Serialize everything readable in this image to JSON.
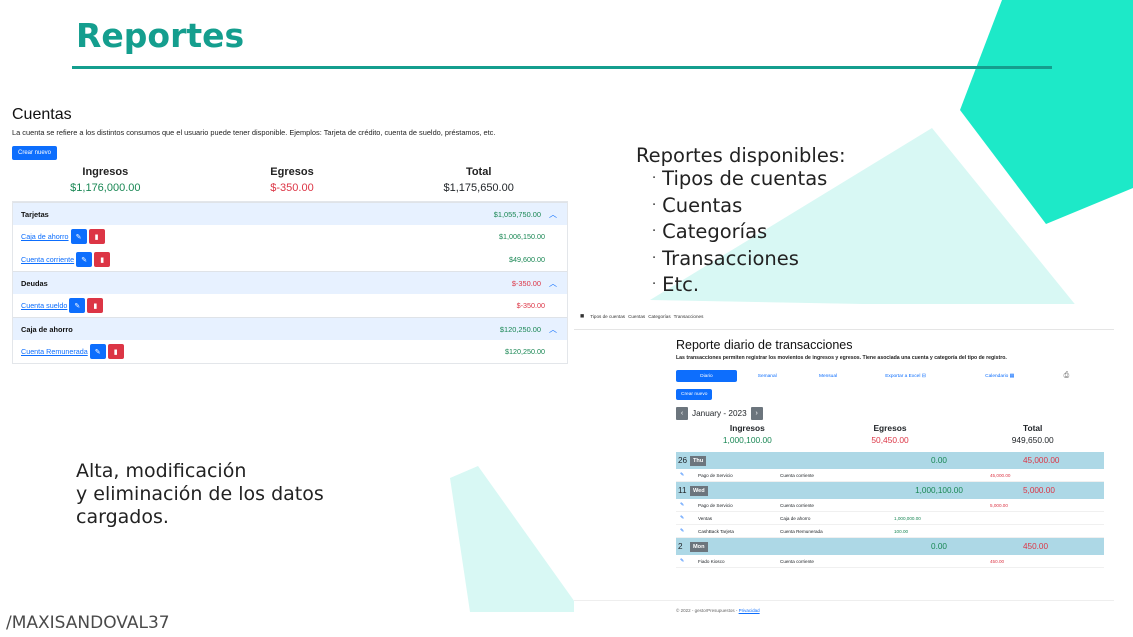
{
  "slide": {
    "title": "Reportes",
    "footer_handle": "/MAXISANDOVAL37",
    "abm_line1": "Alta, modificación",
    "abm_line2": "y eliminación de los datos",
    "abm_line3": "cargados.",
    "reports_heading": "Reportes disponibles:",
    "reports_list": [
      "Tipos de cuentas",
      "Cuentas",
      "Categorías",
      "Transacciones",
      "Etc."
    ],
    "colors": {
      "accent": "#149e8e",
      "deco_teal": "#1de9c8",
      "deco_light": "#d8f8f4"
    }
  },
  "cuentas": {
    "title": "Cuentas",
    "description": "La cuenta se refiere a los distintos consumos que el usuario puede tener disponible. Ejemplos: Tarjeta de crédito, cuenta de sueldo, préstamos, etc.",
    "new_button": "Crear nuevo",
    "summary": {
      "ingresos_label": "Ingresos",
      "ingresos_value": "$1,176,000.00",
      "egresos_label": "Egresos",
      "egresos_value": "$-350.00",
      "total_label": "Total",
      "total_value": "$1,175,650.00"
    },
    "groups": [
      {
        "name": "Tarjetas",
        "total": "$1,055,750.00",
        "total_color": "green",
        "accounts": [
          {
            "name": "Caja de ahorro",
            "amount": "$1,006,150.00",
            "color": "green"
          },
          {
            "name": "Cuenta corriente",
            "amount": "$49,600.00",
            "color": "green"
          }
        ]
      },
      {
        "name": "Deudas",
        "total": "$-350.00",
        "total_color": "red",
        "accounts": [
          {
            "name": "Cuenta sueldo",
            "amount": "$-350.00",
            "color": "red"
          }
        ]
      },
      {
        "name": "Caja de ahorro",
        "total": "$120,250.00",
        "total_color": "green",
        "accounts": [
          {
            "name": "Cuenta Remunerada",
            "amount": "$120,250.00",
            "color": "green"
          }
        ]
      }
    ]
  },
  "reporte": {
    "nav": [
      "Tipos de cuentas",
      "Cuentas",
      "Categorías",
      "Transacciones"
    ],
    "title": "Reporte diario de transacciones",
    "description": "Las transacciones permiten registrar los movientos de ingresos y egresos. Tiene asociada una cuenta y categoría del tipo de registro.",
    "tabs": [
      "Diario",
      "Semanal",
      "Mensual",
      "Exportar a Excel",
      "Calendario"
    ],
    "new_button": "Crear nuevo",
    "month": "January - 2023",
    "summary": {
      "ingresos_label": "Ingresos",
      "ingresos_value": "1,000,100.00",
      "egresos_label": "Egresos",
      "egresos_value": "50,450.00",
      "total_label": "Total",
      "total_value": "949,650.00"
    },
    "days": [
      {
        "num": "26",
        "name": "Thu",
        "in": "0.00",
        "out": "45,000.00",
        "rows": [
          {
            "category": "Pago de Servicio",
            "account": "Cuenta corriente",
            "in": "",
            "out": "45,000.00"
          }
        ]
      },
      {
        "num": "11",
        "name": "Wed",
        "in": "1,000,100.00",
        "out": "5,000.00",
        "rows": [
          {
            "category": "Pago de Servicio",
            "account": "Cuenta corriente",
            "in": "",
            "out": "5,000.00"
          },
          {
            "category": "Ventas",
            "account": "Caja de ahorro",
            "in": "1,000,000.00",
            "out": ""
          },
          {
            "category": "CashBack Tarjeta",
            "account": "Cuenta Remunerada",
            "in": "100.00",
            "out": ""
          }
        ]
      },
      {
        "num": "2",
        "name": "Mon",
        "in": "0.00",
        "out": "450.00",
        "rows": [
          {
            "category": "Fiado Kiosco",
            "account": "Cuenta corriente",
            "in": "",
            "out": "450.00"
          }
        ]
      }
    ],
    "footer_text": "© 2022 - gestorPresupuestos - ",
    "footer_link": "Privacidad"
  }
}
